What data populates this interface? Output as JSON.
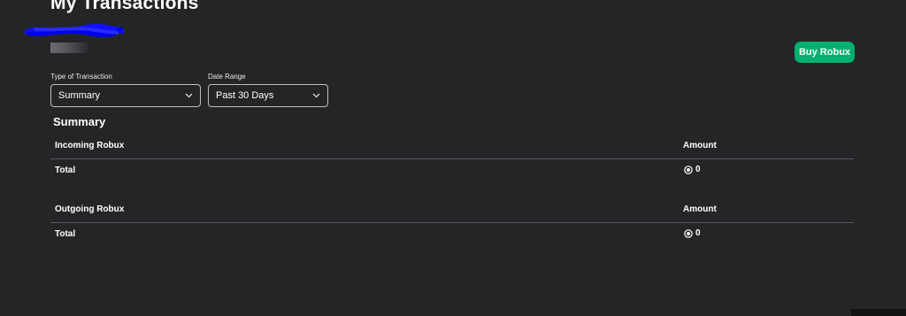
{
  "header": {
    "title": "My Transactions"
  },
  "actions": {
    "buy_label": "Buy Robux"
  },
  "filters": {
    "type_label": "Type of Transaction",
    "type_value": "Summary",
    "range_label": "Date Range",
    "range_value": "Past 30 Days"
  },
  "summary": {
    "title": "Summary",
    "incoming": {
      "header_label": "Incoming Robux",
      "amount_header": "Amount",
      "total_label": "Total",
      "total_value": "0"
    },
    "outgoing": {
      "header_label": "Outgoing Robux",
      "amount_header": "Amount",
      "total_label": "Total",
      "total_value": "0"
    }
  },
  "icons": {
    "chevron": "chevron-down-icon",
    "currency": "robux-icon"
  },
  "colors": {
    "background": "#232527",
    "accent": "#00b06f",
    "divider": "#56585b",
    "text": "#ffffff"
  }
}
